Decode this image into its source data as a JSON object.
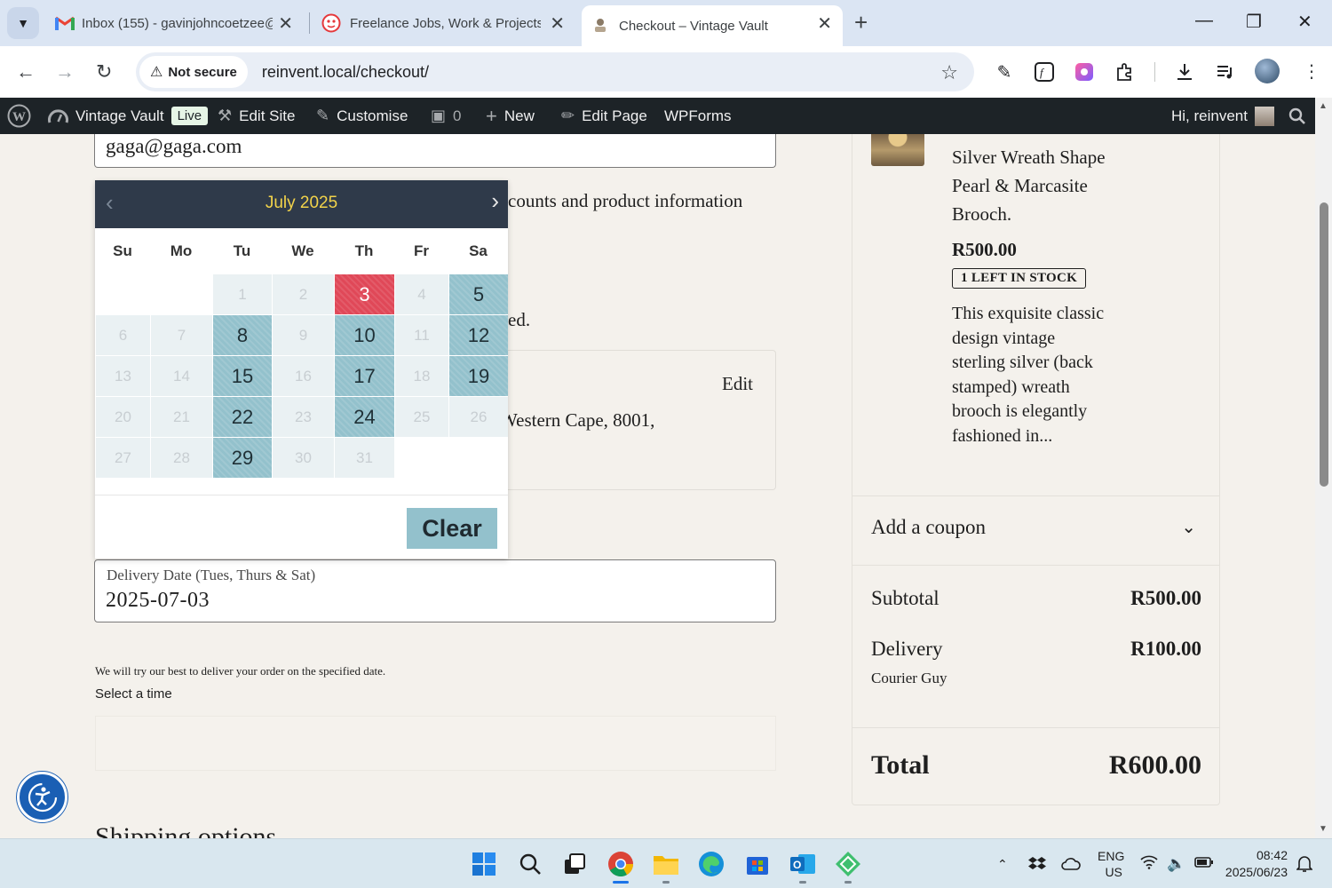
{
  "browser": {
    "tabs": [
      {
        "title": "Inbox (155) - gavinjohncoetzee@",
        "icon": "gmail-icon"
      },
      {
        "title": "Freelance Jobs, Work & Projects",
        "icon": "freelancer-icon"
      },
      {
        "title": "Checkout – Vintage Vault",
        "icon": "vintage-vault-icon"
      }
    ],
    "security_label": "Not secure",
    "url": "reinvent.local/checkout/"
  },
  "adminbar": {
    "site_name": "Vintage Vault",
    "live_badge": "Live",
    "edit_site": "Edit Site",
    "customise": "Customise",
    "comments_count": "0",
    "new_label": "New",
    "edit_page": "Edit Page",
    "wpforms": "WPForms",
    "greeting": "Hi, reinvent"
  },
  "form": {
    "email_value": "gaga@gaga.com",
    "marketing_text_partial": "counts and product information",
    "partial_line": "ed.",
    "address_partial": "Western Cape, 8001,",
    "edit_label": "Edit",
    "delivery_date_label": "Delivery Date (Tues, Thurs & Sat)",
    "delivery_date_value": "2025-07-03",
    "delivery_note": "We will try our best to deliver your order on the specified date.",
    "select_time_label": "Select a time",
    "shipping_heading": "Shipping options"
  },
  "datepicker": {
    "month_title": "July 2025",
    "weekdays": [
      "Su",
      "Mo",
      "Tu",
      "We",
      "Th",
      "Fr",
      "Sa"
    ],
    "weeks": [
      [
        "",
        "",
        "1",
        "2",
        "3",
        "4",
        "5"
      ],
      [
        "6",
        "7",
        "8",
        "9",
        "10",
        "11",
        "12"
      ],
      [
        "13",
        "14",
        "15",
        "16",
        "17",
        "18",
        "19"
      ],
      [
        "20",
        "21",
        "22",
        "23",
        "24",
        "25",
        "26"
      ],
      [
        "27",
        "28",
        "29",
        "30",
        "31",
        "",
        ""
      ]
    ],
    "available_days": [
      "5",
      "8",
      "10",
      "12",
      "15",
      "17",
      "19",
      "22",
      "24",
      "29"
    ],
    "selected_day": "3",
    "clear_label": "Clear"
  },
  "summary": {
    "product_name": "Silver Wreath Shape Pearl & Marcasite Brooch.",
    "price": "R500.00",
    "stock_badge": "1 LEFT IN STOCK",
    "description": "This exquisite classic design vintage sterling silver (back stamped) wreath brooch is elegantly fashioned in...",
    "coupon_label": "Add a coupon",
    "subtotal_label": "Subtotal",
    "subtotal_value": "R500.00",
    "delivery_label": "Delivery",
    "delivery_value": "R100.00",
    "delivery_method": "Courier Guy",
    "total_label": "Total",
    "total_value": "R600.00"
  },
  "taskbar": {
    "language": "ENG",
    "region": "US",
    "time": "08:42",
    "date": "2025/06/23"
  },
  "colors": {
    "admin_bar": "#1d2327",
    "datepicker_header": "#2f3a4a",
    "datepicker_title": "#f2d34a",
    "available_day": "#93c1cc",
    "selected_day": "#e04858",
    "page_background": "#f4f1ec"
  }
}
